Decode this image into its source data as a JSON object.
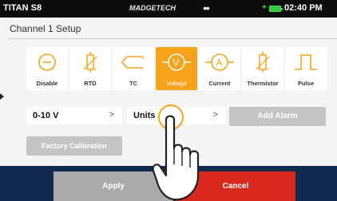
{
  "status_bar": {
    "device": "TITAN S8",
    "brand": "MADGETECH",
    "time": "02:40 PM",
    "usb_icon": "usb-icon",
    "battery_icon": "battery-icon"
  },
  "page": {
    "title": "Channel 1 Setup"
  },
  "sensor_types": [
    {
      "label": "Disable",
      "icon": "disable-icon"
    },
    {
      "label": "RTD",
      "icon": "rtd-icon"
    },
    {
      "label": "TC",
      "icon": "thermocouple-icon"
    },
    {
      "label": "Voltage",
      "icon": "voltage-icon"
    },
    {
      "label": "Current",
      "icon": "current-icon"
    },
    {
      "label": "Thermistor",
      "icon": "thermistor-icon"
    },
    {
      "label": "Pulse",
      "icon": "pulse-icon"
    }
  ],
  "selected_sensor": "Voltage",
  "controls": {
    "range_value": "0-10 V",
    "units_label": "Units",
    "chevron": ">",
    "add_alarm": "Add Alarm",
    "factory_calibration": "Factory Calibration"
  },
  "footer": {
    "apply": "Apply",
    "cancel": "Cancel"
  },
  "colors": {
    "accent": "#f7a21b",
    "cancel": "#d9291e",
    "bottom_bar": "#102b4e",
    "disabled": "#c4c4c4"
  }
}
